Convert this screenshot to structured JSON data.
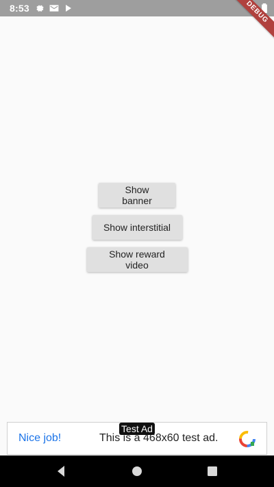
{
  "status_bar": {
    "time": "8:53",
    "icons": [
      "settings-icon",
      "mail-icon",
      "play-store-icon",
      "wifi-icon",
      "battery-icon"
    ]
  },
  "debug_banner": {
    "label": "DEBUG"
  },
  "buttons": {
    "show_banner": "Show banner",
    "show_interstitial": "Show interstitial",
    "show_reward_video": "Show reward video"
  },
  "ad": {
    "badge": "Test Ad",
    "headline": "Nice job!",
    "description": "This is a 468x60 test ad."
  },
  "navigation": {
    "items": [
      "back-icon",
      "home-icon",
      "recents-icon"
    ]
  },
  "colors": {
    "background": "#fafafa",
    "status_bar": "#9e9e9e",
    "button": "#e0e0e0",
    "ad_link": "#1a73e8",
    "debug_ribbon": "#b0413e"
  }
}
